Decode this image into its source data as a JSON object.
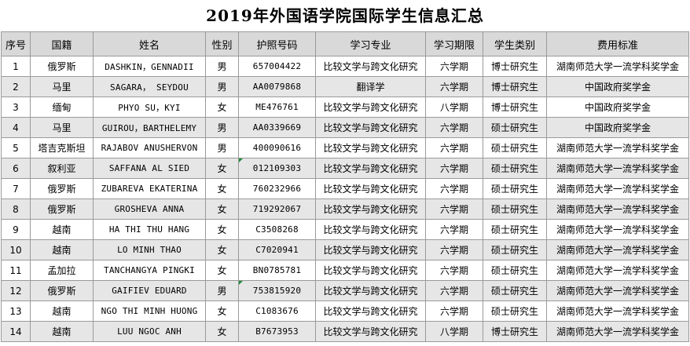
{
  "title": "2019年外国语学院国际学生信息汇总",
  "headers": [
    "序号",
    "国籍",
    "姓名",
    "性别",
    "护照号码",
    "学习专业",
    "学习期限",
    "学生类别",
    "费用标准"
  ],
  "rows": [
    {
      "no": "1",
      "nat": "俄罗斯",
      "name": "DASHKIN，GENNADII",
      "sex": "男",
      "passport": "657004422",
      "major": "比较文学与跨文化研究",
      "term": "六学期",
      "type": "博士研究生",
      "fee": "湖南师范大学一流学科奖学金"
    },
    {
      "no": "2",
      "nat": "马里",
      "name": "SAGARA， SEYDOU",
      "sex": "男",
      "passport": "AA0079868",
      "major": "翻译学",
      "term": "六学期",
      "type": "博士研究生",
      "fee": "中国政府奖学金"
    },
    {
      "no": "3",
      "nat": "缅甸",
      "name": "PHYO SU，KYI",
      "sex": "女",
      "passport": "ME476761",
      "major": "比较文学与跨文化研究",
      "term": "八学期",
      "type": "博士研究生",
      "fee": "中国政府奖学金"
    },
    {
      "no": "4",
      "nat": "马里",
      "name": "GUIROU，BARTHELEMY",
      "sex": "男",
      "passport": "AA0339669",
      "major": "比较文学与跨文化研究",
      "term": "六学期",
      "type": "硕士研究生",
      "fee": "中国政府奖学金"
    },
    {
      "no": "5",
      "nat": "塔吉克斯坦",
      "name": "RAJABOV ANUSHERVON",
      "sex": "男",
      "passport": "400090616",
      "major": "比较文学与跨文化研究",
      "term": "六学期",
      "type": "硕士研究生",
      "fee": "湖南师范大学一流学科奖学金"
    },
    {
      "no": "6",
      "nat": "叙利亚",
      "name": "SAFFANA AL SIED",
      "sex": "女",
      "passport": "012109303",
      "major": "比较文学与跨文化研究",
      "term": "六学期",
      "type": "硕士研究生",
      "fee": "湖南师范大学一流学科奖学金",
      "mark": true
    },
    {
      "no": "7",
      "nat": "俄罗斯",
      "name": "ZUBAREVA EKATERINA",
      "sex": "女",
      "passport": "760232966",
      "major": "比较文学与跨文化研究",
      "term": "六学期",
      "type": "硕士研究生",
      "fee": "湖南师范大学一流学科奖学金"
    },
    {
      "no": "8",
      "nat": "俄罗斯",
      "name": "GROSHEVA ANNA",
      "sex": "女",
      "passport": "719292067",
      "major": "比较文学与跨文化研究",
      "term": "六学期",
      "type": "硕士研究生",
      "fee": "湖南师范大学一流学科奖学金"
    },
    {
      "no": "9",
      "nat": "越南",
      "name": "HA THI THU HANG",
      "sex": "女",
      "passport": "C3508268",
      "major": "比较文学与跨文化研究",
      "term": "六学期",
      "type": "硕士研究生",
      "fee": "湖南师范大学一流学科奖学金"
    },
    {
      "no": "10",
      "nat": "越南",
      "name": "LO MINH THAO",
      "sex": "女",
      "passport": "C7020941",
      "major": "比较文学与跨文化研究",
      "term": "六学期",
      "type": "硕士研究生",
      "fee": "湖南师范大学一流学科奖学金"
    },
    {
      "no": "11",
      "nat": "孟加拉",
      "name": "TANCHANGYA PINGKI",
      "sex": "女",
      "passport": "BN0785781",
      "major": "比较文学与跨文化研究",
      "term": "六学期",
      "type": "硕士研究生",
      "fee": "湖南师范大学一流学科奖学金"
    },
    {
      "no": "12",
      "nat": "俄罗斯",
      "name": "GAIFIEV EDUARD",
      "sex": "男",
      "passport": "753815920",
      "major": "比较文学与跨文化研究",
      "term": "六学期",
      "type": "硕士研究生",
      "fee": "湖南师范大学一流学科奖学金",
      "mark": true
    },
    {
      "no": "13",
      "nat": "越南",
      "name": "NGO THI MINH HUONG",
      "sex": "女",
      "passport": "C1083676",
      "major": "比较文学与跨文化研究",
      "term": "六学期",
      "type": "硕士研究生",
      "fee": "湖南师范大学一流学科奖学金"
    },
    {
      "no": "14",
      "nat": "越南",
      "name": "LUU NGOC ANH",
      "sex": "女",
      "passport": "B7673953",
      "major": "比较文学与跨文化研究",
      "term": "八学期",
      "type": "博士研究生",
      "fee": "湖南师范大学一流学科奖学金"
    }
  ]
}
